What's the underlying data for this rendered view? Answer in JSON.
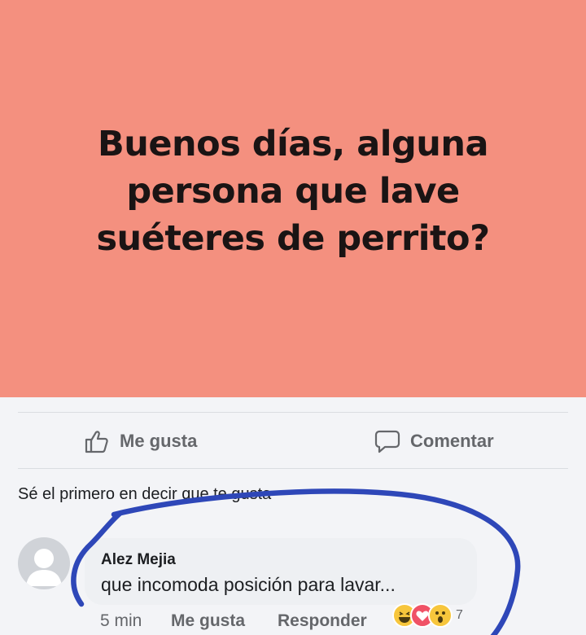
{
  "post": {
    "text_lines": [
      "Buenos días, alguna",
      "persona que lave",
      "suéteres de perrito?"
    ],
    "background_color": "#f4907f"
  },
  "actions": {
    "like_label": "Me gusta",
    "comment_label": "Comentar"
  },
  "likes_prompt": "Sé el primero en decir que te gusta",
  "comment": {
    "author": "Alez Mejia",
    "text": "que incomoda posición para lavar...",
    "time": "5 min",
    "like_label": "Me gusta",
    "reply_label": "Responder",
    "reaction_icons": [
      "haha-reaction-icon",
      "love-reaction-icon",
      "wow-reaction-icon"
    ],
    "reaction_count": "7"
  },
  "annotation_color": "#2e47b8"
}
